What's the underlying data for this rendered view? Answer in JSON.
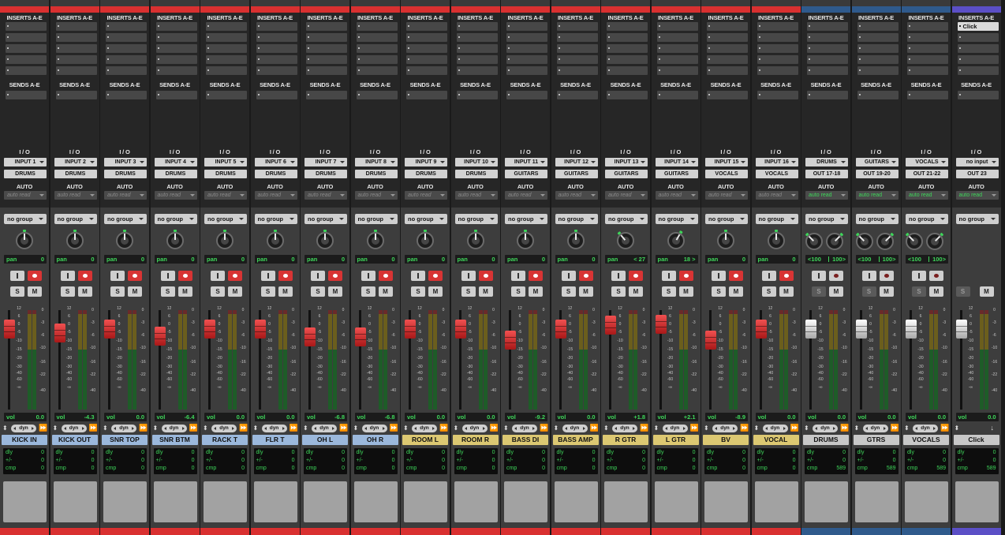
{
  "colors": {
    "red_bar": "#d93030",
    "blue_bar": "#2f5a8c",
    "purple_bar": "#5b4fc6",
    "name_blue": "#9bb8dc",
    "name_yellow": "#dcc872",
    "name_gray": "#c8c8c8",
    "fader_red": "#d83434",
    "fader_white": "#e8e8e8",
    "green_text": "#3ed65a"
  },
  "labels": {
    "inserts": "INSERTS A-E",
    "sends": "SENDS A-E",
    "io": "I / O",
    "auto": "AUTO",
    "group": "no group",
    "pan": "pan",
    "vol": "vol",
    "dyn": "dyn",
    "dly": "dly",
    "pm": "+/-",
    "cmp": "cmp",
    "solo": "S",
    "mute": "M"
  },
  "icons": [
    "send-slot-icon",
    "insert-slot-icon",
    "pan-knob-icon",
    "input-monitor-icon",
    "record-enable-icon",
    "automation-arrow-icon",
    "timebase-arrow-icon",
    "fast-forward-icon",
    "down-arrow-icon"
  ],
  "scales": {
    "fader": [
      "12",
      "6",
      "0",
      "-5",
      "-10",
      "-15",
      "-20",
      "-30",
      "-40",
      "-60",
      "-∞"
    ],
    "meter": [
      "0",
      "-3",
      "-6",
      "-10",
      "-16",
      "-22",
      "-40"
    ]
  },
  "tracks": [
    {
      "name": "KICK IN",
      "name_color": "blue",
      "bar": "red",
      "input": "INPUT 1",
      "output": "DRUMS",
      "auto": "auto read",
      "pan": [
        "0"
      ],
      "vol": "0.0",
      "fader_db": 0.0,
      "type": "audio",
      "cmp": "0",
      "insert": ""
    },
    {
      "name": "KICK OUT",
      "name_color": "blue",
      "bar": "red",
      "input": "INPUT 2",
      "output": "DRUMS",
      "auto": "auto read",
      "pan": [
        "0"
      ],
      "vol": "-4.3",
      "fader_db": -4.3,
      "type": "audio",
      "cmp": "0",
      "insert": ""
    },
    {
      "name": "SNR TOP",
      "name_color": "blue",
      "bar": "red",
      "input": "INPUT 3",
      "output": "DRUMS",
      "auto": "auto read",
      "pan": [
        "0"
      ],
      "vol": "0.0",
      "fader_db": 0.0,
      "type": "audio",
      "cmp": "0",
      "insert": ""
    },
    {
      "name": "SNR BTM",
      "name_color": "blue",
      "bar": "red",
      "input": "INPUT 4",
      "output": "DRUMS",
      "auto": "auto read",
      "pan": [
        "0"
      ],
      "vol": "-6.4",
      "fader_db": -6.4,
      "type": "audio",
      "cmp": "0",
      "insert": ""
    },
    {
      "name": "RACK T",
      "name_color": "blue",
      "bar": "red",
      "input": "INPUT 5",
      "output": "DRUMS",
      "auto": "auto read",
      "pan": [
        "0"
      ],
      "vol": "0.0",
      "fader_db": 0.0,
      "type": "audio",
      "cmp": "0",
      "insert": ""
    },
    {
      "name": "FLR T",
      "name_color": "blue",
      "bar": "red",
      "input": "INPUT 6",
      "output": "DRUMS",
      "auto": "auto read",
      "pan": [
        "0"
      ],
      "vol": "0.0",
      "fader_db": 0.0,
      "type": "audio",
      "cmp": "0",
      "insert": ""
    },
    {
      "name": "OH L",
      "name_color": "blue",
      "bar": "red",
      "input": "INPUT 7",
      "output": "DRUMS",
      "auto": "auto read",
      "pan": [
        "0"
      ],
      "vol": "-6.8",
      "fader_db": -6.8,
      "type": "audio",
      "cmp": "0",
      "insert": ""
    },
    {
      "name": "OH R",
      "name_color": "blue",
      "bar": "red",
      "input": "INPUT 8",
      "output": "DRUMS",
      "auto": "auto read",
      "pan": [
        "0"
      ],
      "vol": "-6.8",
      "fader_db": -6.8,
      "type": "audio",
      "cmp": "0",
      "insert": ""
    },
    {
      "name": "ROOM L",
      "name_color": "yellow",
      "bar": "red",
      "input": "INPUT 9",
      "output": "DRUMS",
      "auto": "auto read",
      "pan": [
        "0"
      ],
      "vol": "0.0",
      "fader_db": 0.0,
      "type": "audio",
      "cmp": "0",
      "insert": ""
    },
    {
      "name": "ROOM R",
      "name_color": "yellow",
      "bar": "red",
      "input": "INPUT 10",
      "output": "DRUMS",
      "auto": "auto read",
      "pan": [
        "0"
      ],
      "vol": "0.0",
      "fader_db": 0.0,
      "type": "audio",
      "cmp": "0",
      "insert": ""
    },
    {
      "name": "BASS DI",
      "name_color": "yellow",
      "bar": "red",
      "input": "INPUT 11",
      "output": "GUITARS",
      "auto": "auto read",
      "pan": [
        "0"
      ],
      "vol": "-9.2",
      "fader_db": -9.2,
      "type": "audio",
      "cmp": "0",
      "insert": ""
    },
    {
      "name": "BASS AMP",
      "name_color": "yellow",
      "bar": "red",
      "input": "INPUT 12",
      "output": "GUITARS",
      "auto": "auto read",
      "pan": [
        "0"
      ],
      "vol": "0.0",
      "fader_db": 0.0,
      "type": "audio",
      "cmp": "0",
      "insert": ""
    },
    {
      "name": "R GTR",
      "name_color": "yellow",
      "bar": "red",
      "input": "INPUT 13",
      "output": "GUITARS",
      "auto": "auto read",
      "pan": [
        "< 27"
      ],
      "pan_left": true,
      "vol": "+1.8",
      "fader_db": 1.8,
      "type": "audio",
      "cmp": "0",
      "insert": ""
    },
    {
      "name": "L GTR",
      "name_color": "yellow",
      "bar": "red",
      "input": "INPUT 14",
      "output": "GUITARS",
      "auto": "auto read",
      "pan": [
        "18 >"
      ],
      "pan_right": true,
      "vol": "+2.1",
      "fader_db": 2.1,
      "type": "audio",
      "cmp": "0",
      "insert": ""
    },
    {
      "name": "BV",
      "name_color": "yellow",
      "bar": "red",
      "input": "INPUT 15",
      "output": "VOCALS",
      "auto": "auto read",
      "pan": [
        "0"
      ],
      "vol": "-8.9",
      "fader_db": -8.9,
      "type": "audio",
      "cmp": "0",
      "insert": ""
    },
    {
      "name": "VOCAL",
      "name_color": "yellow",
      "bar": "red",
      "input": "INPUT 16",
      "output": "VOCALS",
      "auto": "auto read",
      "pan": [
        "0"
      ],
      "vol": "0.0",
      "fader_db": 0.0,
      "type": "audio",
      "cmp": "0",
      "insert": ""
    },
    {
      "name": "DRUMS",
      "name_color": "gray",
      "bar": "blue",
      "input": "DRUMS",
      "output": "OUT 17-18",
      "auto": "auto read",
      "pan": [
        "<100",
        "100>"
      ],
      "vol": "0.0",
      "fader_db": 0.0,
      "type": "aux",
      "cmp": "589",
      "insert": ""
    },
    {
      "name": "GTRS",
      "name_color": "gray",
      "bar": "blue",
      "input": "GUITARS",
      "output": "OUT 19-20",
      "auto": "auto read",
      "pan": [
        "<100",
        "100>"
      ],
      "vol": "0.0",
      "fader_db": 0.0,
      "type": "aux",
      "cmp": "589",
      "insert": ""
    },
    {
      "name": "VOCALS",
      "name_color": "gray",
      "bar": "blue",
      "input": "VOCALS",
      "output": "OUT 21-22",
      "auto": "auto read",
      "pan": [
        "<100",
        "100>"
      ],
      "vol": "0.0",
      "fader_db": 0.0,
      "type": "aux",
      "cmp": "589",
      "insert": ""
    },
    {
      "name": "Click",
      "name_color": "gray",
      "bar": "purple",
      "input": "no input",
      "output": "OUT 23",
      "auto": "auto read",
      "pan": [],
      "vol": "0.0",
      "fader_db": 0.0,
      "type": "click",
      "cmp": "589",
      "insert": "Click"
    }
  ]
}
